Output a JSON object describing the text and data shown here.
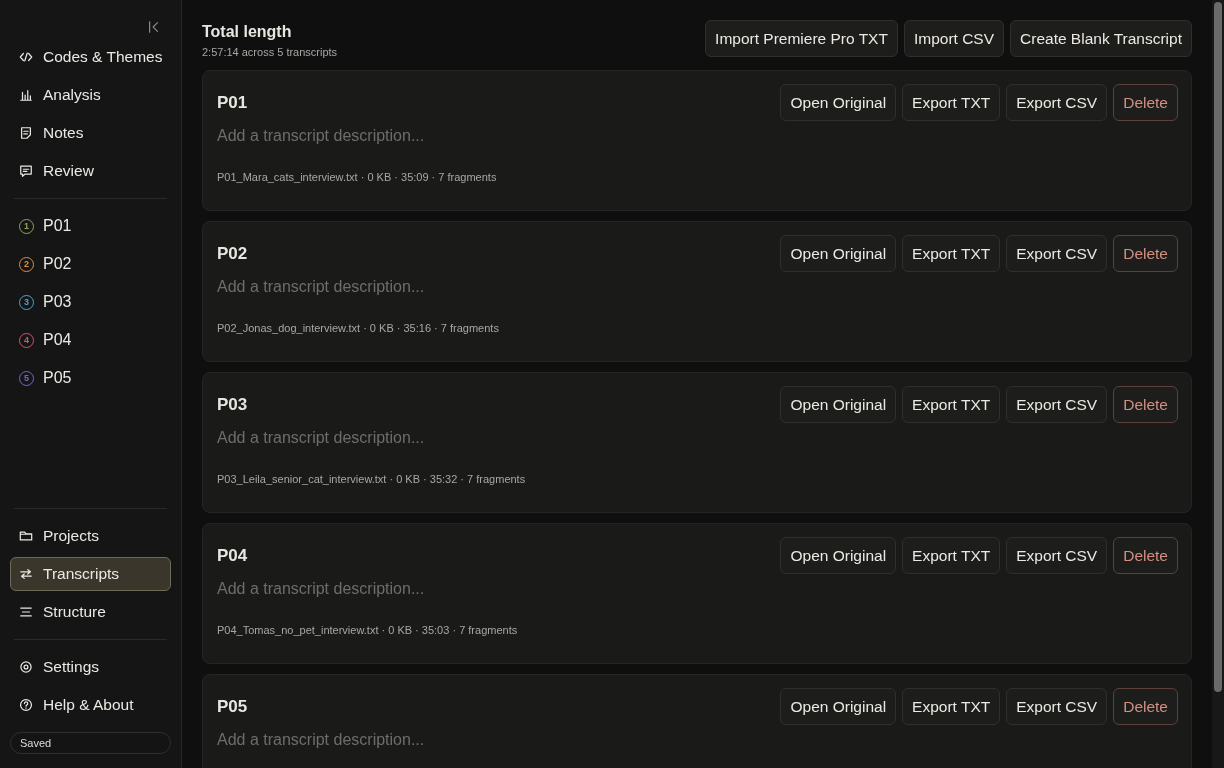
{
  "sidebar": {
    "top_items": [
      {
        "label": "Codes & Themes",
        "selected": false
      },
      {
        "label": "Analysis",
        "selected": false
      },
      {
        "label": "Notes",
        "selected": false
      },
      {
        "label": "Review",
        "selected": false
      }
    ],
    "participants": [
      {
        "number": "1",
        "label": "P01",
        "color": "#8fa35a"
      },
      {
        "number": "2",
        "label": "P02",
        "color": "#d9914a"
      },
      {
        "number": "3",
        "label": "P03",
        "color": "#4aa3d1"
      },
      {
        "number": "4",
        "label": "P04",
        "color": "#d1566a"
      },
      {
        "number": "5",
        "label": "P05",
        "color": "#7a63c9"
      }
    ],
    "bottom_items": [
      {
        "label": "Projects",
        "selected": false
      },
      {
        "label": "Transcripts",
        "selected": true
      },
      {
        "label": "Structure",
        "selected": false
      }
    ],
    "footer_items": [
      {
        "label": "Settings",
        "selected": false
      },
      {
        "label": "Help & About",
        "selected": false
      }
    ],
    "status": "Saved"
  },
  "header": {
    "title": "Total length",
    "subtitle": "2:57:14 across 5 transcripts",
    "buttons": [
      "Import Premiere Pro TXT",
      "Import CSV",
      "Create Blank Transcript"
    ]
  },
  "transcripts": [
    {
      "title": "P01",
      "placeholder": "Add a transcript description...",
      "meta": "P01_Mara_cats_interview.txt · 0 KB · 35:09 · 7 fragments",
      "buttons": [
        {
          "label": "Open Original",
          "kind": "normal"
        },
        {
          "label": "Export TXT",
          "kind": "normal"
        },
        {
          "label": "Export CSV",
          "kind": "normal"
        },
        {
          "label": "Delete",
          "kind": "danger"
        }
      ]
    },
    {
      "title": "P02",
      "placeholder": "Add a transcript description...",
      "meta": "P02_Jonas_dog_interview.txt · 0 KB · 35:16 · 7 fragments",
      "buttons": [
        {
          "label": "Open Original",
          "kind": "normal"
        },
        {
          "label": "Export TXT",
          "kind": "normal"
        },
        {
          "label": "Export CSV",
          "kind": "normal"
        },
        {
          "label": "Delete",
          "kind": "danger"
        }
      ]
    },
    {
      "title": "P03",
      "placeholder": "Add a transcript description...",
      "meta": "P03_Leila_senior_cat_interview.txt · 0 KB · 35:32 · 7 fragments",
      "buttons": [
        {
          "label": "Open Original",
          "kind": "normal"
        },
        {
          "label": "Export TXT",
          "kind": "normal"
        },
        {
          "label": "Export CSV",
          "kind": "normal"
        },
        {
          "label": "Delete",
          "kind": "danger"
        }
      ]
    },
    {
      "title": "P04",
      "placeholder": "Add a transcript description...",
      "meta": "P04_Tomas_no_pet_interview.txt · 0 KB · 35:03 · 7 fragments",
      "buttons": [
        {
          "label": "Open Original",
          "kind": "normal"
        },
        {
          "label": "Export TXT",
          "kind": "normal"
        },
        {
          "label": "Export CSV",
          "kind": "normal"
        },
        {
          "label": "Delete",
          "kind": "danger"
        }
      ]
    },
    {
      "title": "P05",
      "placeholder": "Add a transcript description...",
      "buttons": [
        {
          "label": "Open Original",
          "kind": "normal"
        },
        {
          "label": "Export TXT",
          "kind": "normal"
        },
        {
          "label": "Export CSV",
          "kind": "normal"
        },
        {
          "label": "Delete",
          "kind": "danger"
        }
      ]
    }
  ]
}
